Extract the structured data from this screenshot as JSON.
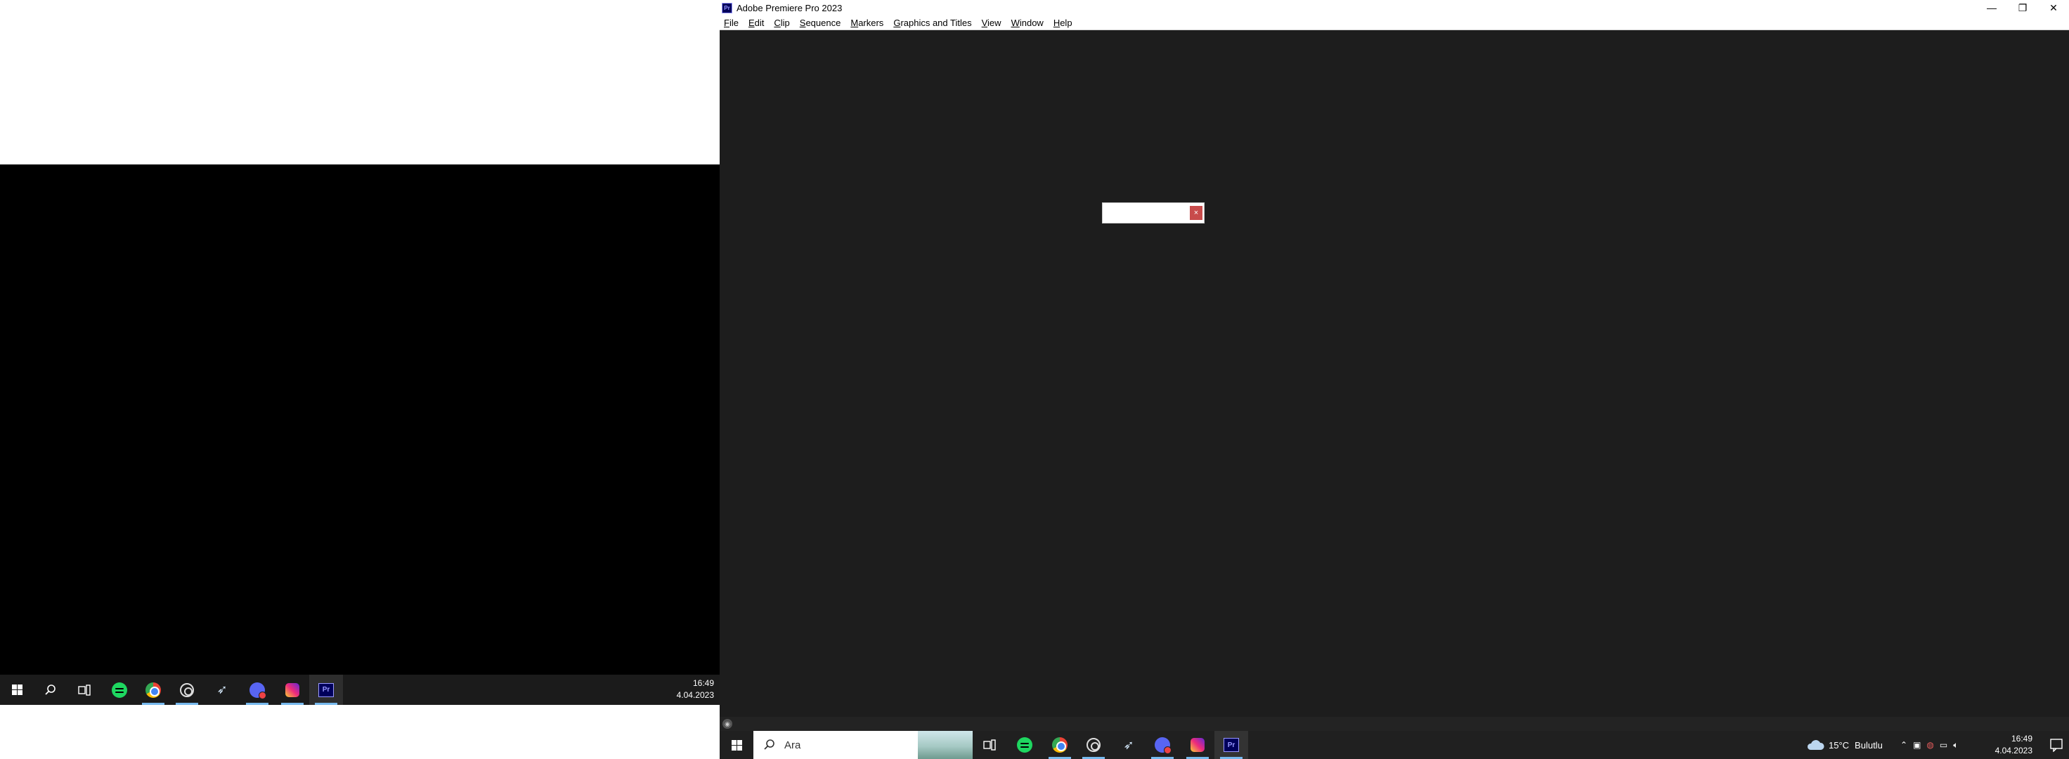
{
  "left_taskbar": {
    "apps": [
      {
        "name": "start",
        "icon": "windows-icon"
      },
      {
        "name": "search",
        "icon": "search-icon"
      },
      {
        "name": "task-view",
        "icon": "task-view-icon"
      },
      {
        "name": "spotify",
        "icon": "spotify-icon"
      },
      {
        "name": "chrome",
        "icon": "chrome-icon"
      },
      {
        "name": "obs",
        "icon": "obs-icon"
      },
      {
        "name": "steam",
        "icon": "steam-icon"
      },
      {
        "name": "discord",
        "icon": "discord-icon"
      },
      {
        "name": "instagram",
        "icon": "instagram-icon"
      },
      {
        "name": "premiere",
        "icon": "premiere-icon",
        "label": "Pr"
      }
    ],
    "clock_time": "16:49",
    "clock_date": "4.04.2023"
  },
  "premiere": {
    "title": "Adobe Premiere Pro 2023",
    "app_icon_label": "Pr",
    "menu": [
      {
        "first": "F",
        "rest": "ile"
      },
      {
        "first": "E",
        "rest": "dit"
      },
      {
        "first": "C",
        "rest": "lip"
      },
      {
        "first": "S",
        "rest": "equence"
      },
      {
        "first": "M",
        "rest": "arkers"
      },
      {
        "first": "G",
        "rest": "raphics and Titles"
      },
      {
        "first": "V",
        "rest": "iew"
      },
      {
        "first": "W",
        "rest": "indow"
      },
      {
        "first": "H",
        "rest": "elp"
      }
    ],
    "window_controls": {
      "minimize": "—",
      "restore": "❐",
      "close": "✕"
    },
    "popup_close": "×"
  },
  "right_taskbar": {
    "search_placeholder": "Ara",
    "weather_temp": "15°C",
    "weather_text": "Bulutlu",
    "clock_time": "16:49",
    "clock_date": "4.04.2023",
    "pr_label": "Pr"
  },
  "colors": {
    "premiere_bg": "#1d1d1d",
    "taskbar_bg": "#202020",
    "active_underline": "#76b9ed",
    "popup_close": "#c84b4b"
  }
}
